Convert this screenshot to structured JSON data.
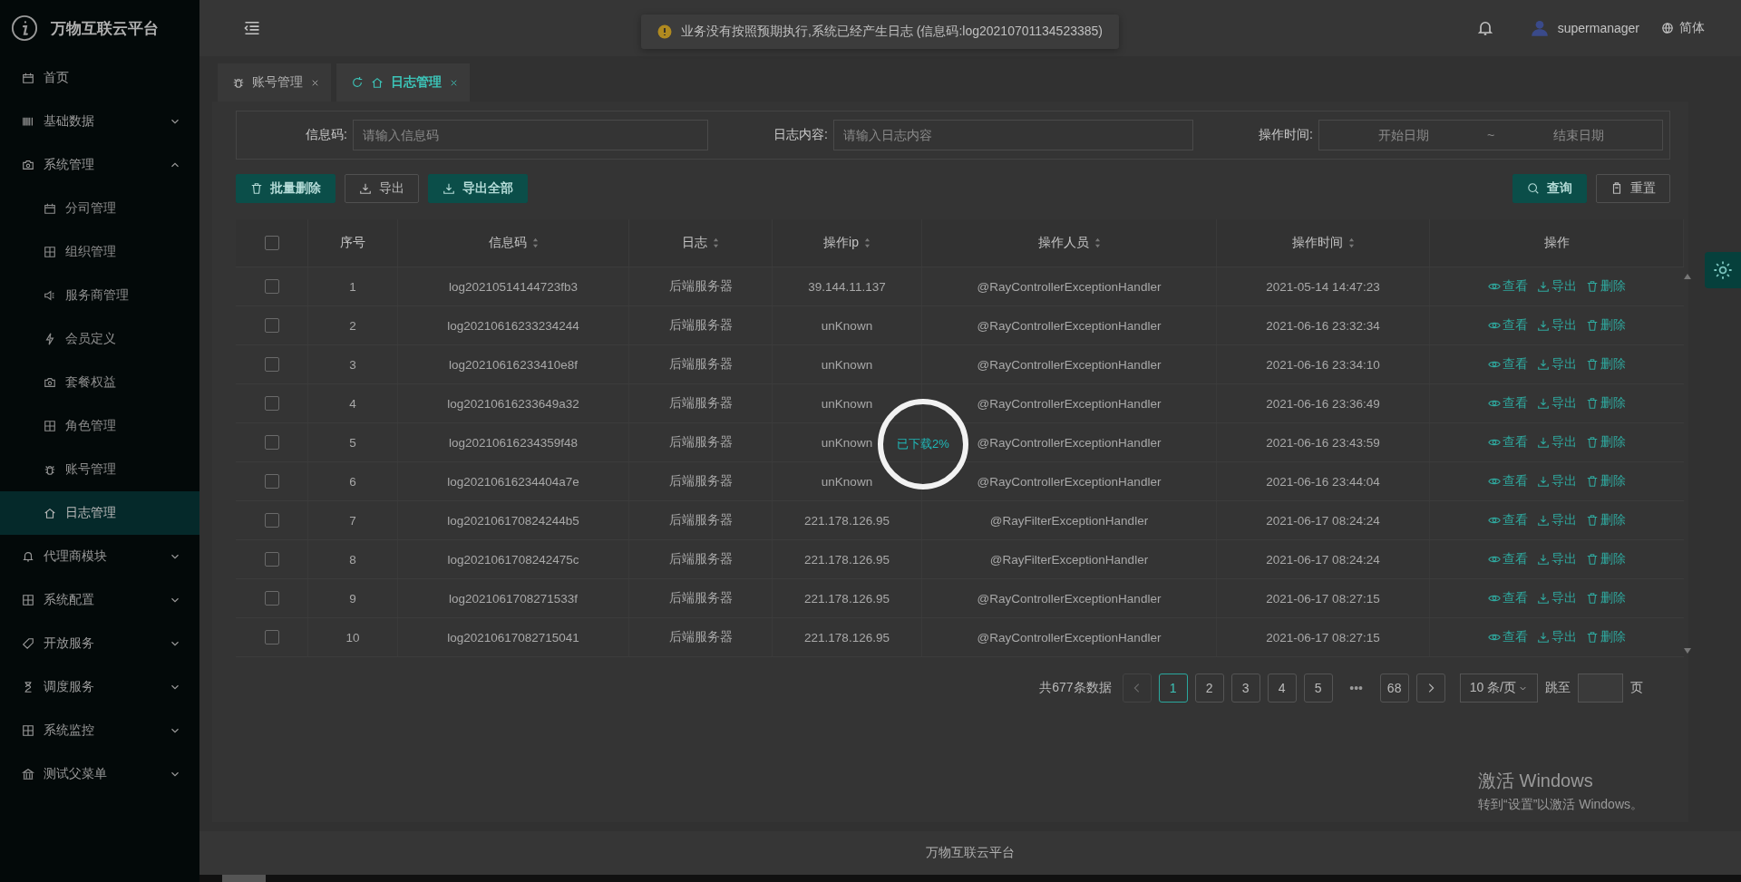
{
  "sidebar": {
    "title": "万物互联云平台",
    "menu": [
      {
        "label": "首页",
        "kind": "link"
      },
      {
        "label": "基础数据",
        "kind": "group",
        "expanded": false
      },
      {
        "label": "系统管理",
        "kind": "group",
        "expanded": true,
        "children": [
          {
            "label": "分司管理",
            "selected": false
          },
          {
            "label": "组织管理",
            "selected": false
          },
          {
            "label": "服务商管理",
            "selected": false
          },
          {
            "label": "会员定义",
            "selected": false
          },
          {
            "label": "套餐权益",
            "selected": false
          },
          {
            "label": "角色管理",
            "selected": false
          },
          {
            "label": "账号管理",
            "selected": false
          },
          {
            "label": "日志管理",
            "selected": true
          }
        ]
      },
      {
        "label": "代理商模块",
        "kind": "group",
        "expanded": false
      },
      {
        "label": "系统配置",
        "kind": "group",
        "expanded": false
      },
      {
        "label": "开放服务",
        "kind": "group",
        "expanded": false
      },
      {
        "label": "调度服务",
        "kind": "group",
        "expanded": false
      },
      {
        "label": "系统监控",
        "kind": "group",
        "expanded": false
      },
      {
        "label": "测试父菜单",
        "kind": "group",
        "expanded": false
      }
    ]
  },
  "header": {
    "notice": "业务没有按照预期执行,系统已经产生日志 (信息码:log20210701134523385)",
    "user": "supermanager",
    "language": "简体"
  },
  "tabs": [
    {
      "label": "账号管理",
      "selected": false
    },
    {
      "label": "日志管理",
      "selected": true
    }
  ],
  "filters": [
    {
      "label": "信息码:",
      "placeholder": "请输入信息码"
    },
    {
      "label": "日志内容:",
      "placeholder": "请输入日志内容"
    }
  ],
  "date_range": {
    "label": "操作时间:",
    "start_placeholder": "开始日期",
    "separator": "~",
    "end_placeholder": "结束日期"
  },
  "toolbar": [
    {
      "label": "批量删除",
      "kind": "primary"
    },
    {
      "label": "导出",
      "kind": "plain"
    },
    {
      "label": "导出全部",
      "kind": "primary"
    }
  ],
  "search_actions": [
    {
      "label": "查询",
      "kind": "primary"
    },
    {
      "label": "重置",
      "kind": "plain"
    }
  ],
  "table": {
    "select_all_checked": false,
    "columns": [
      {
        "label": "序号",
        "sortable": false
      },
      {
        "label": "信息码",
        "sortable": true
      },
      {
        "label": "日志",
        "sortable": true
      },
      {
        "label": "操作ip",
        "sortable": true
      },
      {
        "label": "操作人员",
        "sortable": true
      },
      {
        "label": "操作时间",
        "sortable": true
      },
      {
        "label": "操作",
        "sortable": false
      }
    ],
    "rows": [
      {
        "checked": false,
        "cells": [
          "1",
          "log20210514144723fb3",
          "后端服务器",
          "39.144.11.137",
          "@RayControllerExceptionHandler",
          "2021-05-14 14:47:23"
        ],
        "actions": [
          "查看",
          "导出",
          "删除"
        ]
      },
      {
        "checked": false,
        "cells": [
          "2",
          "log20210616233234244",
          "后端服务器",
          "unKnown",
          "@RayControllerExceptionHandler",
          "2021-06-16 23:32:34"
        ],
        "actions": [
          "查看",
          "导出",
          "删除"
        ]
      },
      {
        "checked": false,
        "cells": [
          "3",
          "log20210616233410e8f",
          "后端服务器",
          "unKnown",
          "@RayControllerExceptionHandler",
          "2021-06-16 23:34:10"
        ],
        "actions": [
          "查看",
          "导出",
          "删除"
        ]
      },
      {
        "checked": false,
        "cells": [
          "4",
          "log20210616233649a32",
          "后端服务器",
          "unKnown",
          "@RayControllerExceptionHandler",
          "2021-06-16 23:36:49"
        ],
        "actions": [
          "查看",
          "导出",
          "删除"
        ]
      },
      {
        "checked": false,
        "cells": [
          "5",
          "log20210616234359f48",
          "后端服务器",
          "unKnown",
          "@RayControllerExceptionHandler",
          "2021-06-16 23:43:59"
        ],
        "actions": [
          "查看",
          "导出",
          "删除"
        ]
      },
      {
        "checked": false,
        "cells": [
          "6",
          "log20210616234404a7e",
          "后端服务器",
          "unKnown",
          "@RayControllerExceptionHandler",
          "2021-06-16 23:44:04"
        ],
        "actions": [
          "查看",
          "导出",
          "删除"
        ]
      },
      {
        "checked": false,
        "cells": [
          "7",
          "log202106170824244b5",
          "后端服务器",
          "221.178.126.95",
          "@RayFilterExceptionHandler",
          "2021-06-17 08:24:24"
        ],
        "actions": [
          "查看",
          "导出",
          "删除"
        ]
      },
      {
        "checked": false,
        "cells": [
          "8",
          "log2021061708242475c",
          "后端服务器",
          "221.178.126.95",
          "@RayFilterExceptionHandler",
          "2021-06-17 08:24:24"
        ],
        "actions": [
          "查看",
          "导出",
          "删除"
        ]
      },
      {
        "checked": false,
        "cells": [
          "9",
          "log2021061708271533f",
          "后端服务器",
          "221.178.126.95",
          "@RayControllerExceptionHandler",
          "2021-06-17 08:27:15"
        ],
        "actions": [
          "查看",
          "导出",
          "删除"
        ]
      },
      {
        "checked": false,
        "cells": [
          "10",
          "log20210617082715041",
          "后端服务器",
          "221.178.126.95",
          "@RayControllerExceptionHandler",
          "2021-06-17 08:27:15"
        ],
        "actions": [
          "查看",
          "导出",
          "删除"
        ]
      }
    ]
  },
  "pagination": {
    "total": "共677条数据",
    "prev_disabled": true,
    "next_disabled": false,
    "pages": [
      {
        "label": "1",
        "selected": true
      },
      {
        "label": "2",
        "selected": false
      },
      {
        "label": "3",
        "selected": false
      },
      {
        "label": "4",
        "selected": false
      },
      {
        "label": "5",
        "selected": false
      },
      {
        "label": "•••",
        "kind": "ellipsis",
        "selected": false
      },
      {
        "label": "68",
        "selected": false
      }
    ],
    "page_size": "10 条/页",
    "jump_label": "跳至",
    "jump_suffix": "页"
  },
  "loading": {
    "text": "已下载2%"
  },
  "footer": "万物互联云平台",
  "os_notice": {
    "title": "激活 Windows",
    "subtitle": "转到“设置”以激活 Windows。"
  }
}
